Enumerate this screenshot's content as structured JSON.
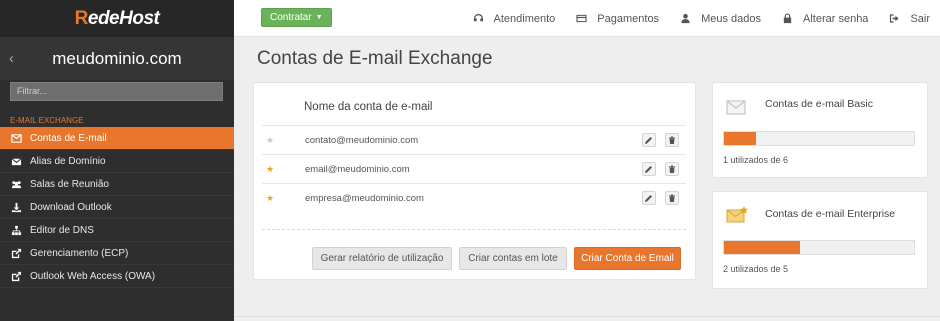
{
  "brand": {
    "logo_r": "R",
    "logo_rest": "edeHost",
    "accent": "#e8762c",
    "sidebar_bg": "#2e2e2e"
  },
  "sidebar": {
    "domain": "meudominio.com",
    "back_icon": "chevron-left-icon",
    "filter_placeholder": "Filtrar...",
    "section_title": "E-MAIL EXCHANGE",
    "items": [
      {
        "label": "Contas de E-mail",
        "icon": "envelope-icon",
        "active": true
      },
      {
        "label": "Alias de Domínio",
        "icon": "envelope-icon",
        "active": false
      },
      {
        "label": "Salas de Reunião",
        "icon": "users-icon",
        "active": false
      },
      {
        "label": "Download Outlook",
        "icon": "download-icon",
        "active": false
      },
      {
        "label": "Editor de DNS",
        "icon": "sitemap-icon",
        "active": false
      },
      {
        "label": "Gerenciamento (ECP)",
        "icon": "external-link-icon",
        "active": false
      },
      {
        "label": "Outlook Web Access (OWA)",
        "icon": "external-link-icon",
        "active": false
      }
    ]
  },
  "topbar": {
    "contratar_label": "Contratar",
    "contratar_color": "#6bb35a",
    "links": [
      {
        "label": "Atendimento",
        "icon": "headset-icon"
      },
      {
        "label": "Pagamentos",
        "icon": "credit-card-icon"
      },
      {
        "label": "Meus dados",
        "icon": "user-icon"
      },
      {
        "label": "Alterar senha",
        "icon": "lock-icon"
      },
      {
        "label": "Sair",
        "icon": "sign-out-icon"
      }
    ]
  },
  "main": {
    "title": "Contas de E-mail Exchange",
    "column_header": "Nome da conta de e-mail",
    "accounts": [
      {
        "email": "contato@meudominio.com",
        "starred": false
      },
      {
        "email": "email@meudominio.com",
        "starred": true
      },
      {
        "email": "empresa@meudominio.com",
        "starred": true
      }
    ],
    "buttons": {
      "report": "Gerar relatório de utilização",
      "batch": "Criar contas em lote",
      "create": "Criar Conta de Email"
    }
  },
  "side": {
    "basic": {
      "title": "Contas de e-mail Basic",
      "used": 1,
      "total": 6,
      "note": "1 utilizados de 6",
      "icon": "envelope-basic-icon"
    },
    "enterprise": {
      "title": "Contas de e-mail Enterprise",
      "used": 2,
      "total": 5,
      "note": "2 utilizados de 5",
      "icon": "envelope-star-icon"
    }
  }
}
